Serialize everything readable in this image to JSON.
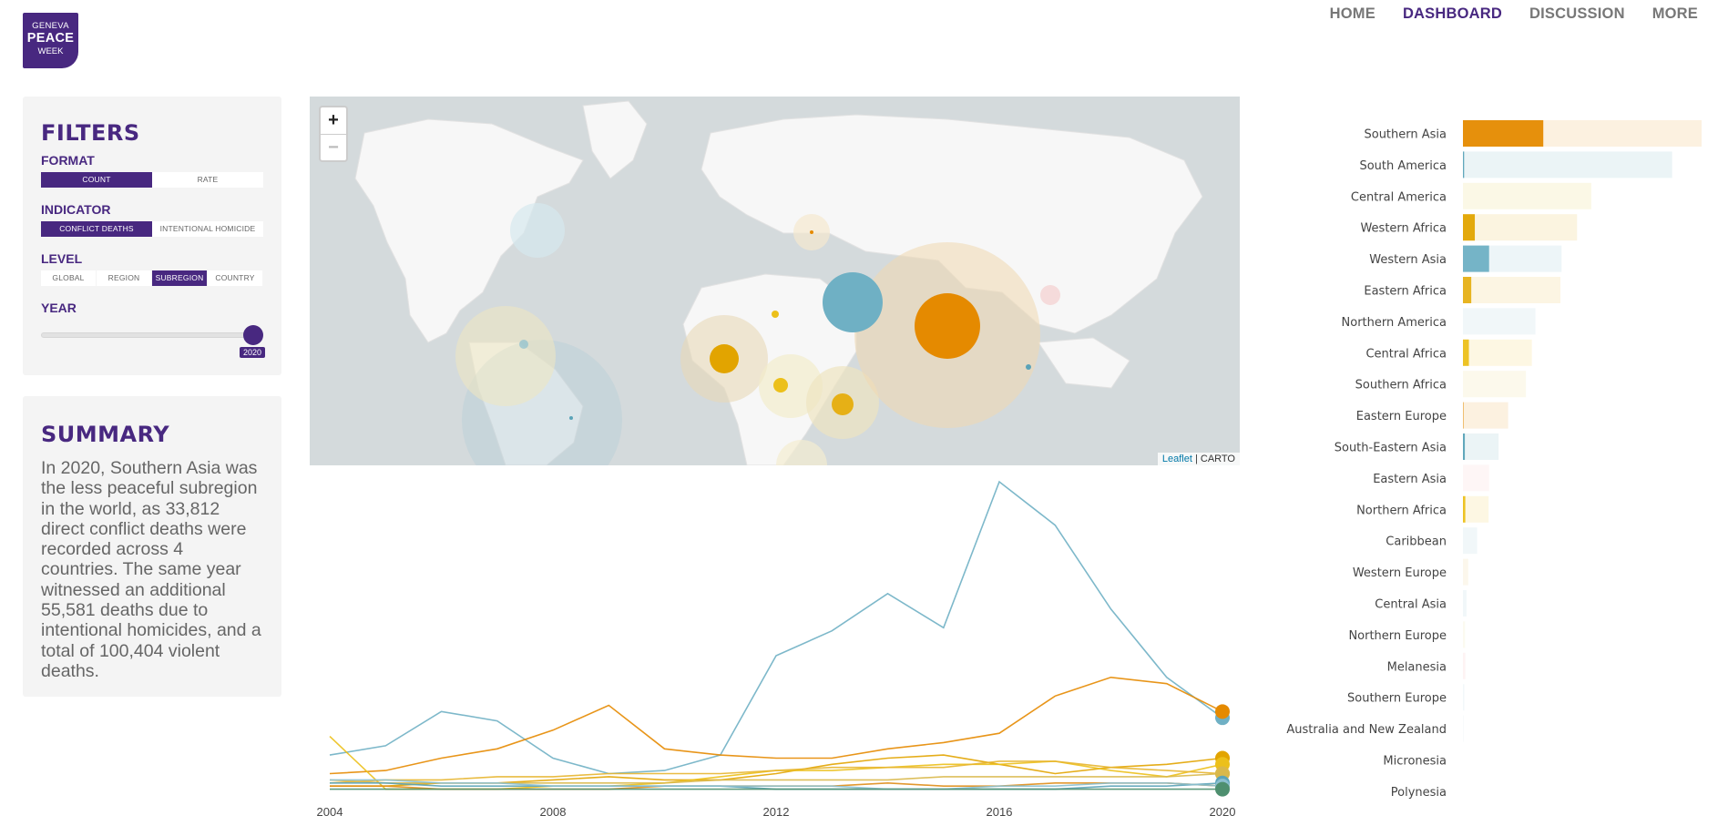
{
  "logo": {
    "line1": "GENEVA",
    "line2": "PEACE",
    "line3": "WEEK"
  },
  "nav": {
    "items": [
      "HOME",
      "DASHBOARD",
      "DISCUSSION",
      "MORE"
    ],
    "active": "DASHBOARD"
  },
  "filters": {
    "title": "FILTERS",
    "format": {
      "label": "FORMAT",
      "options": [
        "COUNT",
        "RATE"
      ],
      "selected": "COUNT"
    },
    "indicator": {
      "label": "INDICATOR",
      "options": [
        "CONFLICT DEATHS",
        "INTENTIONAL HOMICIDE"
      ],
      "selected": "CONFLICT DEATHS"
    },
    "level": {
      "label": "LEVEL",
      "options": [
        "GLOBAL",
        "REGION",
        "SUBREGION",
        "COUNTRY"
      ],
      "selected": "SUBREGION"
    },
    "year": {
      "label": "YEAR",
      "value": "2020"
    }
  },
  "summary": {
    "title": "SUMMARY",
    "text": "In 2020, Southern Asia was the less peaceful subregion in the world, as 33,812 direct conflict deaths were recorded across 4 countries. The same year witnessed an additional 55,581 deaths due to intentional homicides, and a total of 100,404 violent deaths."
  },
  "map": {
    "attribution_leaflet": "Leaflet",
    "attribution_sep": " | ",
    "attribution_carto": "CARTO",
    "zoom_in": "+",
    "zoom_out": "−"
  },
  "colors": {
    "brand": "#482880",
    "teal": "#6fb0c4",
    "orange": "#e58a00",
    "gold": "#e2a400",
    "yellow": "#ecc01a",
    "pink": "#f4b8b8"
  },
  "chart_data": [
    {
      "type": "line",
      "x": [
        2004,
        2005,
        2006,
        2007,
        2008,
        2009,
        2010,
        2011,
        2012,
        2013,
        2014,
        2015,
        2016,
        2017,
        2018,
        2019,
        2020
      ],
      "xticks": [
        "2004",
        "2008",
        "2012",
        "2016",
        "2020"
      ],
      "ylim": [
        0,
        100
      ],
      "series": [
        {
          "color": "#6fb0c4",
          "values": [
            12,
            15,
            26,
            23,
            11,
            6,
            7,
            12,
            44,
            52,
            64,
            53,
            100,
            86,
            59,
            37,
            24
          ]
        },
        {
          "color": "#e58a00",
          "values": [
            6,
            7,
            11,
            14,
            20,
            28,
            14,
            12,
            11,
            11,
            14,
            16,
            19,
            31,
            37,
            35,
            26
          ]
        },
        {
          "color": "#e2a400",
          "values": [
            2,
            2,
            3,
            3,
            4,
            5,
            4,
            4,
            6,
            9,
            11,
            12,
            9,
            6,
            8,
            9,
            11
          ]
        },
        {
          "color": "#ecc01a",
          "values": [
            18,
            1,
            1,
            1,
            2,
            2,
            3,
            5,
            7,
            7,
            8,
            9,
            9,
            10,
            7,
            5,
            9
          ]
        },
        {
          "color": "#e7b52f",
          "values": [
            3,
            4,
            4,
            5,
            5,
            6,
            6,
            6,
            7,
            8,
            8,
            8,
            10,
            10,
            8,
            7,
            6
          ]
        },
        {
          "color": "#d9b84a",
          "values": [
            4,
            3,
            3,
            3,
            3,
            3,
            3,
            4,
            4,
            4,
            4,
            5,
            5,
            5,
            5,
            5,
            6
          ]
        },
        {
          "color": "#df8d18",
          "values": [
            2,
            2,
            1,
            1,
            1,
            1,
            2,
            2,
            2,
            2,
            3,
            2,
            2,
            3,
            3,
            3,
            2
          ]
        },
        {
          "color": "#5aa3b8",
          "values": [
            3,
            3,
            2,
            2,
            2,
            2,
            2,
            2,
            1,
            1,
            1,
            1,
            1,
            1,
            2,
            2,
            3
          ]
        },
        {
          "color": "#8bbfcf",
          "values": [
            4,
            4,
            3,
            3,
            2,
            2,
            2,
            2,
            2,
            2,
            1,
            1,
            2,
            2,
            3,
            3,
            2
          ]
        },
        {
          "color": "#4e8f6f",
          "values": [
            1,
            1,
            1,
            1,
            1,
            1,
            1,
            1,
            1,
            1,
            1,
            1,
            1,
            1,
            1,
            1,
            1
          ]
        }
      ]
    },
    {
      "type": "bar",
      "categories": [
        "Southern Asia",
        "South America",
        "Central America",
        "Western Africa",
        "Western Asia",
        "Eastern Africa",
        "Northern America",
        "Central Africa",
        "Southern Africa",
        "Eastern Europe",
        "South-Eastern Asia",
        "Eastern Asia",
        "Northern Africa",
        "Caribbean",
        "Western Europe",
        "Central Asia",
        "Northern Europe",
        "Melanesia",
        "Southern Europe",
        "Australia and New Zealand",
        "Micronesia",
        "Polynesia"
      ],
      "series": [
        {
          "name": "conflict",
          "values": [
            33.8,
            0.5,
            0,
            5.0,
            11.0,
            3.5,
            0,
            2.5,
            0,
            0.2,
            0.8,
            0,
            1.0,
            0,
            0,
            0,
            0,
            0,
            0,
            0,
            0,
            0
          ]
        },
        {
          "name": "total",
          "values": [
            100.4,
            88.0,
            54.0,
            48.0,
            41.5,
            41.0,
            30.5,
            29.0,
            26.5,
            19.0,
            15.0,
            11.0,
            10.8,
            6.0,
            2.2,
            1.5,
            0.9,
            1.0,
            0.6,
            0.3,
            0,
            0
          ]
        }
      ],
      "colors": [
        "#e58a00",
        "#5aa3b8",
        "#e2c530",
        "#e2a400",
        "#6fb0c4",
        "#e6b016",
        "#8bbfcf",
        "#ecc01a",
        "#e8d060",
        "#e58a00",
        "#5aa3b8",
        "#f4b8b8",
        "#ecc01a",
        "#8bbfcf",
        "#e8c060",
        "#8bbfcf",
        "#e8d880",
        "#f4a0a0",
        "#a0c8d8",
        "#b8d8e0",
        "#cccccc",
        "#cccccc"
      ]
    }
  ]
}
